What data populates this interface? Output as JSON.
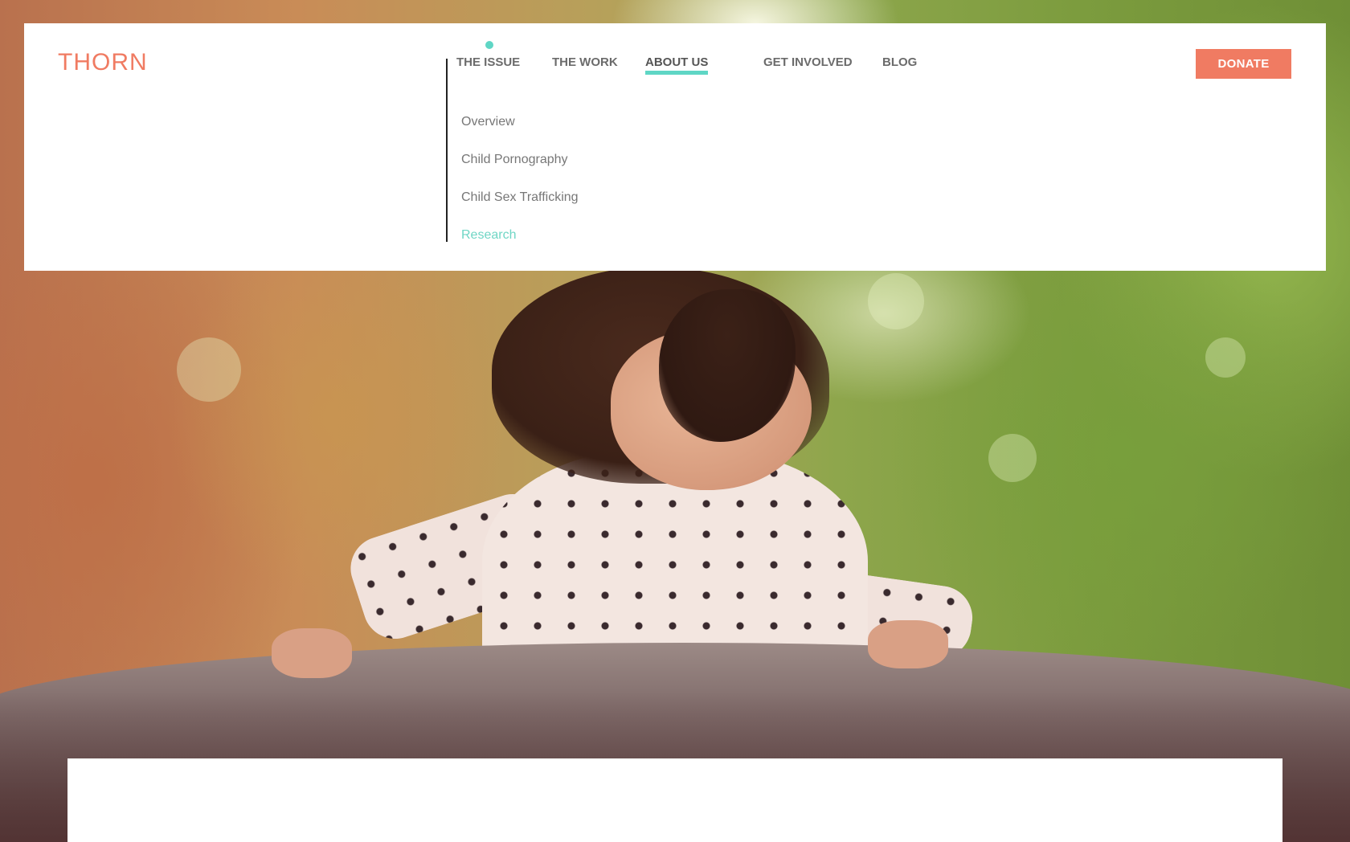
{
  "header": {
    "logo_text": "THORN",
    "nav": [
      {
        "label": "THE ISSUE"
      },
      {
        "label": "THE WORK"
      },
      {
        "label": "ABOUT US"
      },
      {
        "label": "GET INVOLVED"
      },
      {
        "label": "BLOG"
      }
    ],
    "active_nav": "ABOUT US",
    "donate_label": "DONATE"
  },
  "dropdown": {
    "parent": "THE ISSUE",
    "items": [
      {
        "label": "Overview"
      },
      {
        "label": "Child Pornography"
      },
      {
        "label": "Child Sex Trafficking"
      },
      {
        "label": "Research"
      }
    ],
    "current": "Research"
  },
  "colors": {
    "brand": "#f07b62",
    "accent": "#5fd6c5",
    "nav_text": "#6b6b6b",
    "menu_text": "#777777"
  }
}
